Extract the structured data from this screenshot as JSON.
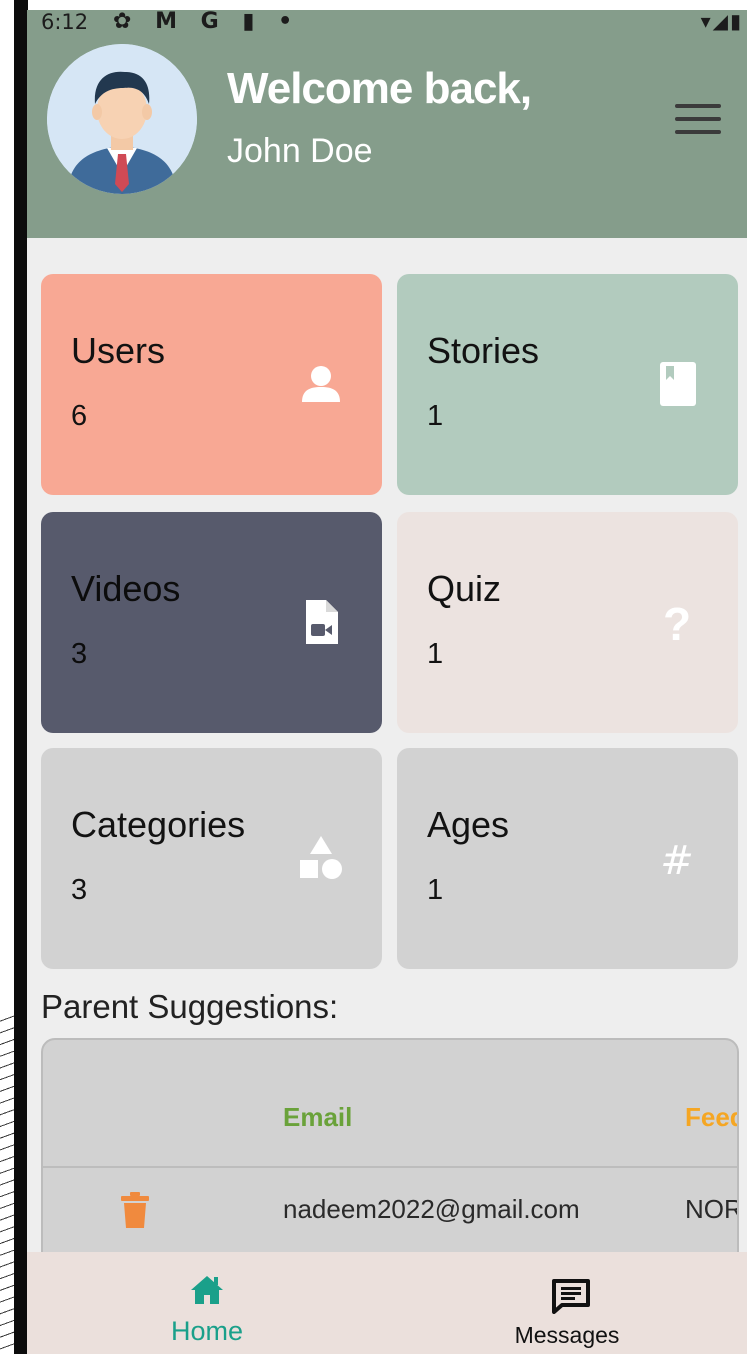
{
  "status_bar": {
    "time": "6:12",
    "icons": [
      "gear-icon",
      "gmail-icon",
      "google-icon",
      "sd-card-icon",
      "dot-icon"
    ],
    "icon_glyphs": "✿ M G ▮ •",
    "right_icons": "▾◢▮"
  },
  "header": {
    "welcome": "Welcome back,",
    "username": "John Doe",
    "background": "#859d8b"
  },
  "cards": [
    {
      "title": "Users",
      "count": "6",
      "icon": "person-icon",
      "color": "#f8a894"
    },
    {
      "title": "Stories",
      "count": "1",
      "icon": "book-icon",
      "color": "#b2cbbe"
    },
    {
      "title": "Videos",
      "count": "3",
      "icon": "video-file-icon",
      "color": "#575a6c"
    },
    {
      "title": "Quiz",
      "count": "1",
      "icon": "question-icon",
      "color": "#ece3e0"
    },
    {
      "title": "Categories",
      "count": "3",
      "icon": "shapes-icon",
      "color": "#d2d2d2"
    },
    {
      "title": "Ages",
      "count": "1",
      "icon": "hash-icon",
      "color": "#d2d2d2"
    }
  ],
  "suggestions": {
    "label": "Parent Suggestions:",
    "columns": {
      "email": "Email",
      "feedback": "Feed"
    },
    "rows": [
      {
        "email": "nadeem2022@gmail.com",
        "feedback": "NOR"
      }
    ]
  },
  "bottom_nav": [
    {
      "label": "Home",
      "icon": "home-icon",
      "active": true
    },
    {
      "label": "Messages",
      "icon": "message-icon",
      "active": false
    }
  ],
  "colors": {
    "accent": "#1aa08a",
    "email_header": "#6aa23a",
    "feedback_header": "#f5a623",
    "trash": "#f08a3e"
  }
}
